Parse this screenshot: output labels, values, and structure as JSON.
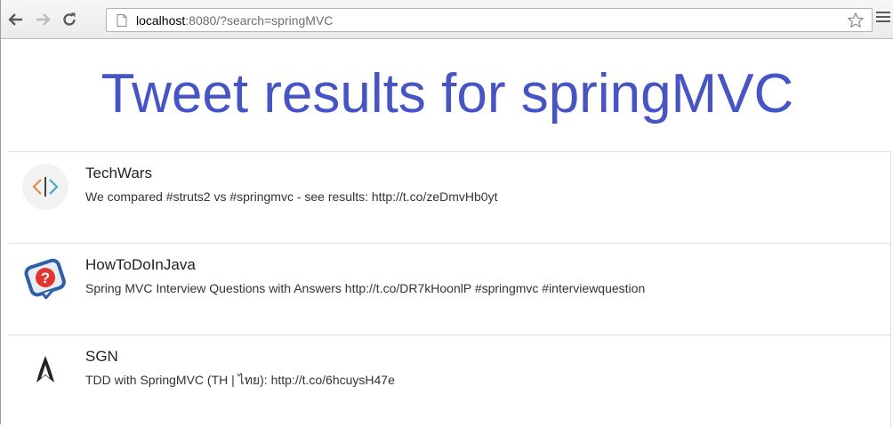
{
  "browser": {
    "url_host": "localhost",
    "url_rest": ":8080/?search=springMVC",
    "back_icon": "arrow-left-icon",
    "forward_icon": "arrow-right-icon",
    "reload_icon": "reload-icon",
    "page_icon": "page-icon",
    "bookmark_icon": "star-icon",
    "menu_icon": "hamburger-menu-icon"
  },
  "page": {
    "title": "Tweet results for springMVC",
    "title_color": "#4655c3"
  },
  "tweets": [
    {
      "user": "TechWars",
      "text": "We compared #struts2 vs #springmvc - see results: http://t.co/zeDmvHb0yt",
      "avatar": "techwars-code-brackets-avatar"
    },
    {
      "user": "HowToDoInJava",
      "text": "Spring MVC Interview Questions with Answers http://t.co/DR7kHoonlP #springmvc #interviewquestion",
      "avatar": "howtodoinjava-question-mark-avatar"
    },
    {
      "user": "SGN",
      "text": "TDD with SpringMVC (TH | ไทย): http://t.co/6hcuysH47e",
      "avatar": "sgn-assassin-logo-avatar"
    }
  ]
}
